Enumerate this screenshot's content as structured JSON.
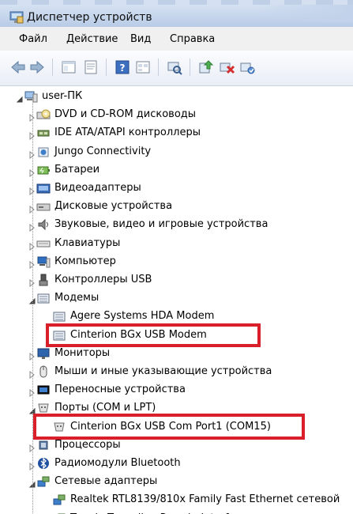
{
  "window": {
    "title": "Диспетчер устройств"
  },
  "menu": [
    "Файл",
    "Действие",
    "Вид",
    "Справка"
  ],
  "toolbar_icons": [
    "back-arrow-icon",
    "forward-arrow-icon",
    "console-tree-icon",
    "properties-icon",
    "help-icon",
    "view-icon",
    "scan-hardware-icon",
    "update-driver-icon",
    "uninstall-device-icon",
    "enable-device-icon"
  ],
  "tree": {
    "root": "user-ПК",
    "categories": [
      {
        "label": "DVD и CD-ROM дисководы",
        "icon": "dvd-drive-icon"
      },
      {
        "label": "IDE ATA/ATAPI контроллеры",
        "icon": "ide-controller-icon"
      },
      {
        "label": "Jungo Connectivity",
        "icon": "jungo-device-icon"
      },
      {
        "label": "Батареи",
        "icon": "battery-icon"
      },
      {
        "label": "Видеоадаптеры",
        "icon": "display-adapter-icon"
      },
      {
        "label": "Дисковые устройства",
        "icon": "disk-drive-icon"
      },
      {
        "label": "Звуковые, видео и игровые устройства",
        "icon": "speaker-icon"
      },
      {
        "label": "Клавиатуры",
        "icon": "keyboard-icon"
      },
      {
        "label": "Компьютер",
        "icon": "computer-icon"
      },
      {
        "label": "Контроллеры USB",
        "icon": "usb-plug-icon"
      },
      {
        "label": "Модемы",
        "icon": "modem-icon",
        "expanded": true,
        "children": [
          {
            "label": "Agere Systems HDA Modem",
            "icon": "modem-icon"
          },
          {
            "label": "Cinterion BGx USB Modem",
            "icon": "modem-icon",
            "highlighted": true
          }
        ]
      },
      {
        "label": "Мониторы",
        "icon": "monitor-icon"
      },
      {
        "label": "Мыши и иные указывающие устройства",
        "icon": "mouse-icon"
      },
      {
        "label": "Переносные устройства",
        "icon": "portable-device-icon"
      },
      {
        "label": "Порты (COM и LPT)",
        "icon": "port-icon",
        "expanded": true,
        "children": [
          {
            "label": "Cinterion BGx USB Com Port1 (COM15)",
            "icon": "port-icon",
            "highlighted": true
          }
        ]
      },
      {
        "label": "Процессоры",
        "icon": "processor-icon"
      },
      {
        "label": "Радиомодули Bluetooth",
        "icon": "bluetooth-icon"
      },
      {
        "label": "Сетевые адаптеры",
        "icon": "network-adapter-icon",
        "expanded": true,
        "children": [
          {
            "label": "Realtek RTL8139/810x Family Fast Ethernet сетевой",
            "icon": "network-adapter-icon"
          },
          {
            "label": "Teredo Tunneling Pseudo-Interface",
            "icon": "network-adapter-icon"
          }
        ]
      }
    ]
  },
  "colors": {
    "highlight": "#d9202a",
    "menu_bg": "#f0f0f0"
  }
}
